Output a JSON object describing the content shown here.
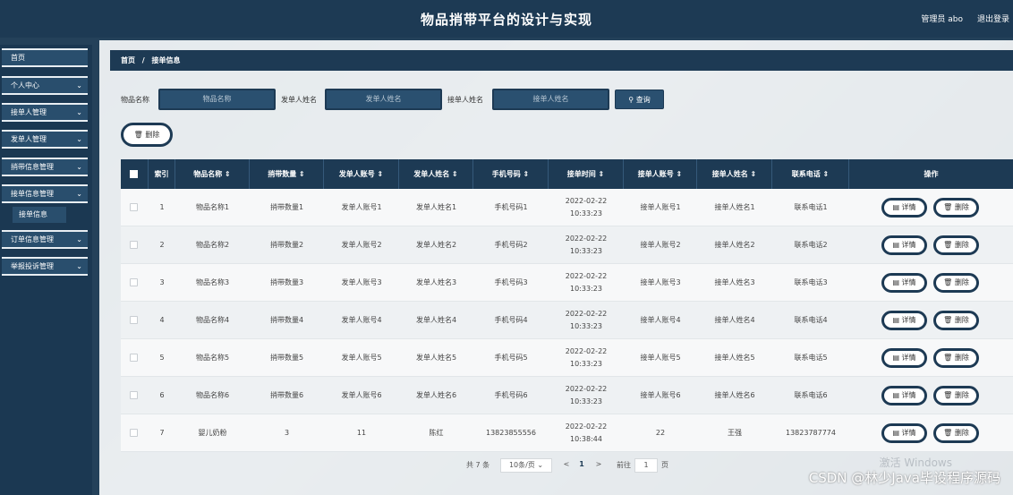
{
  "header": {
    "title": "物品捎带平台的设计与实现",
    "user": "管理员 abo",
    "logout": "退出登录"
  },
  "sidebar": {
    "items": [
      {
        "label": "首页",
        "chev": ""
      },
      {
        "label": "个人中心",
        "chev": "⌄"
      },
      {
        "label": "接单人管理",
        "chev": "⌄"
      },
      {
        "label": "发单人管理",
        "chev": "⌄"
      },
      {
        "label": "捎带信息管理",
        "chev": "⌄"
      },
      {
        "label": "接单信息管理",
        "chev": "⌄"
      },
      {
        "label": "订单信息管理",
        "chev": "⌄"
      },
      {
        "label": "举报投诉管理",
        "chev": "⌄"
      }
    ],
    "sub": "接单信息"
  },
  "breadcrumb": {
    "home": "首页",
    "sep": "/",
    "current": "接单信息"
  },
  "search": {
    "label1": "物品名称",
    "ph1": "物品名称",
    "label2": "发单人姓名",
    "ph2": "发单人姓名",
    "label3": "接单人姓名",
    "ph3": "接单人姓名",
    "button": "查询"
  },
  "delete_button": "删除",
  "table": {
    "headers": [
      "索引",
      "物品名称 ⇕",
      "捎带数量 ⇕",
      "发单人账号 ⇕",
      "发单人姓名 ⇕",
      "手机号码 ⇕",
      "接单时间 ⇕",
      "接单人账号 ⇕",
      "接单人姓名 ⇕",
      "联系电话 ⇕",
      "操作"
    ],
    "rows": [
      [
        "1",
        "物品名称1",
        "捎带数量1",
        "发单人账号1",
        "发单人姓名1",
        "手机号码1",
        "2022-02-22 10:33:23",
        "接单人账号1",
        "接单人姓名1",
        "联系电话1"
      ],
      [
        "2",
        "物品名称2",
        "捎带数量2",
        "发单人账号2",
        "发单人姓名2",
        "手机号码2",
        "2022-02-22 10:33:23",
        "接单人账号2",
        "接单人姓名2",
        "联系电话2"
      ],
      [
        "3",
        "物品名称3",
        "捎带数量3",
        "发单人账号3",
        "发单人姓名3",
        "手机号码3",
        "2022-02-22 10:33:23",
        "接单人账号3",
        "接单人姓名3",
        "联系电话3"
      ],
      [
        "4",
        "物品名称4",
        "捎带数量4",
        "发单人账号4",
        "发单人姓名4",
        "手机号码4",
        "2022-02-22 10:33:23",
        "接单人账号4",
        "接单人姓名4",
        "联系电话4"
      ],
      [
        "5",
        "物品名称5",
        "捎带数量5",
        "发单人账号5",
        "发单人姓名5",
        "手机号码5",
        "2022-02-22 10:33:23",
        "接单人账号5",
        "接单人姓名5",
        "联系电话5"
      ],
      [
        "6",
        "物品名称6",
        "捎带数量6",
        "发单人账号6",
        "发单人姓名6",
        "手机号码6",
        "2022-02-22 10:33:23",
        "接单人账号6",
        "接单人姓名6",
        "联系电话6"
      ],
      [
        "7",
        "婴儿奶粉",
        "3",
        "11",
        "陈红",
        "13823855556",
        "2022-02-22 10:38:44",
        "22",
        "王强",
        "13823787774"
      ]
    ],
    "detail_label": "详情",
    "delete_label": "删除"
  },
  "pagination": {
    "total": "共 7 条",
    "page_size": "10条/页",
    "prev": "<",
    "page": "1",
    "next": ">",
    "goto": "前往",
    "goto_value": "1",
    "page_unit": "页"
  },
  "overlay_text": {
    "activate": "激活 Windows",
    "csdn": "CSDN @林少Java毕设程序源码"
  },
  "colors": {
    "header": "#1d3a54",
    "sidebar": "#1b3852",
    "accent": "#2a5070"
  }
}
